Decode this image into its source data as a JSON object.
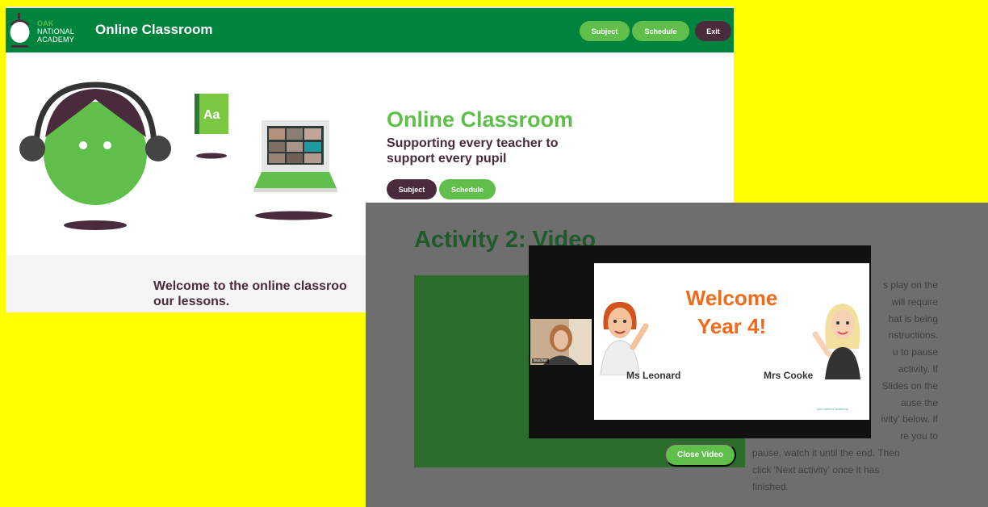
{
  "home": {
    "logo": {
      "line1": "OAK",
      "line2": "NATIONAL",
      "line3": "ACADEMY"
    },
    "header": {
      "title": "Online Classroom",
      "buttons": {
        "subject": "Subject",
        "schedule": "Schedule",
        "exit": "Exit"
      }
    },
    "hero": {
      "title": "Online Classroom",
      "subtitle": "Supporting every teacher to support every pupil",
      "book_label": "Aa",
      "buttons": {
        "subject": "Subject",
        "schedule": "Schedule"
      }
    },
    "welcome_text": "Welcome to the online classroo",
    "welcome_text_line2": "our lessons."
  },
  "activity": {
    "title": "Activity 2: Video",
    "instructions": [
      "s play on the",
      "will require",
      "hat is being",
      "nstructions.",
      "u to pause",
      "activity. If",
      "Slides on the",
      "ause the",
      "ivity' below. If",
      "re you to",
      "pause, watch it until the end. Then",
      "click 'Next activity' once it has",
      "finished."
    ],
    "close_button": "Close Video"
  },
  "video": {
    "slide": {
      "title_line1": "Welcome",
      "title_line2": "Year 4!",
      "teacher_left": "Ms Leonard",
      "teacher_right": "Mrs Cooke",
      "footer": "oak national academy"
    },
    "camera_label": "teacher"
  },
  "colors": {
    "brand_green": "#00843d",
    "accent_green": "#5fbf4a",
    "plum": "#4a2b3d",
    "slide_orange": "#f06a1a",
    "highlight_yellow": "#ffff00"
  }
}
